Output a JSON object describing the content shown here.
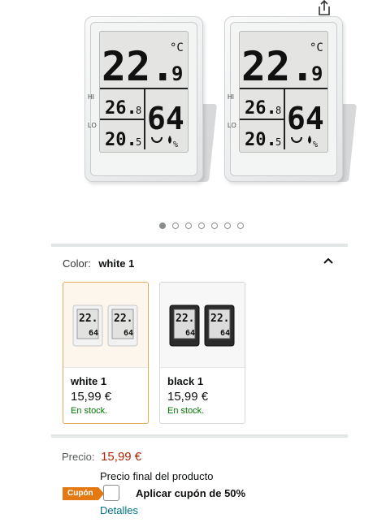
{
  "product_images": {
    "devices": [
      {
        "main_temp": "22.",
        "main_decimal": "9",
        "main_unit": "°C",
        "hi_label": "HI",
        "lo_label": "LO",
        "max_temp": "26.",
        "max_decimal": "8",
        "min_temp": "20.",
        "min_decimal": "5",
        "humidity": "64",
        "humidity_unit": "%"
      },
      {
        "main_temp": "22.",
        "main_decimal": "9",
        "main_unit": "°C",
        "hi_label": "HI",
        "lo_label": "LO",
        "max_temp": "26.",
        "max_decimal": "8",
        "min_temp": "20.",
        "min_decimal": "5",
        "humidity": "64",
        "humidity_unit": "%"
      }
    ]
  },
  "carousel": {
    "count": 7,
    "active_index": 0
  },
  "color_selector": {
    "label": "Color:",
    "selected_value": "white 1",
    "options": [
      {
        "name": "white 1",
        "price": "15,99 €",
        "stock": "En stock.",
        "variant": "white",
        "selected": true
      },
      {
        "name": "black 1",
        "price": "15,99 €",
        "stock": "En stock.",
        "variant": "black",
        "selected": false
      }
    ]
  },
  "pricing": {
    "label": "Precio:",
    "value": "15,99 €",
    "final_label": "Precio final del producto"
  },
  "coupon": {
    "badge": "Cupón",
    "text": "Aplicar cupón de 50%",
    "details_link": "Detalles",
    "checked": false
  },
  "colors": {
    "price_red": "#b12704",
    "stock_green": "#007600",
    "coupon_orange": "#e47911",
    "link_teal": "#007185",
    "selected_border": "#e5a95a"
  },
  "icons": {
    "share": "share-icon",
    "collapse": "chevron-up-icon"
  }
}
